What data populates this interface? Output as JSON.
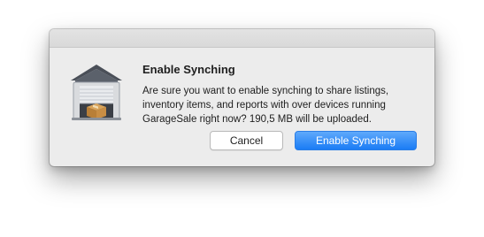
{
  "dialog": {
    "title": "Enable Synching",
    "message": "Are sure you want to enable synching to share listings, inventory items, and reports with over devices running GarageSale right now? 190,5 MB will be uploaded.",
    "icon": "garage-app-icon",
    "buttons": {
      "cancel_label": "Cancel",
      "confirm_label": "Enable Synching"
    }
  },
  "colors": {
    "dialog_background": "#ececec",
    "primary_button": "#1a7cf5",
    "primary_button_text": "#ffffff",
    "text": "#1e1e1e"
  }
}
